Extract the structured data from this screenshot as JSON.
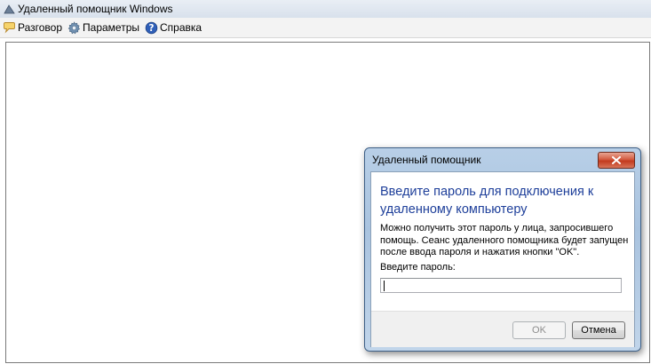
{
  "window": {
    "title": "Удаленный помощник Windows"
  },
  "menu": {
    "items": [
      {
        "label": "Разговор",
        "icon": "chat-icon"
      },
      {
        "label": "Параметры",
        "icon": "gear-icon"
      },
      {
        "label": "Справка",
        "icon": "help-icon"
      }
    ]
  },
  "dialog": {
    "title": "Удаленный помощник",
    "heading": "Введите пароль для подключения к удаленному компьютеру",
    "description": "Можно получить этот пароль у лица, запросившего помощь.  Сеанс удаленного помощника будет запущен после ввода пароля и нажатия кнопки \"OK\".",
    "password_label": "Введите пароль:",
    "password_value": "",
    "ok_label": "OK",
    "cancel_label": "Отмена"
  },
  "colors": {
    "heading": "#1e3f9a",
    "close_button": "#c23a1e"
  }
}
